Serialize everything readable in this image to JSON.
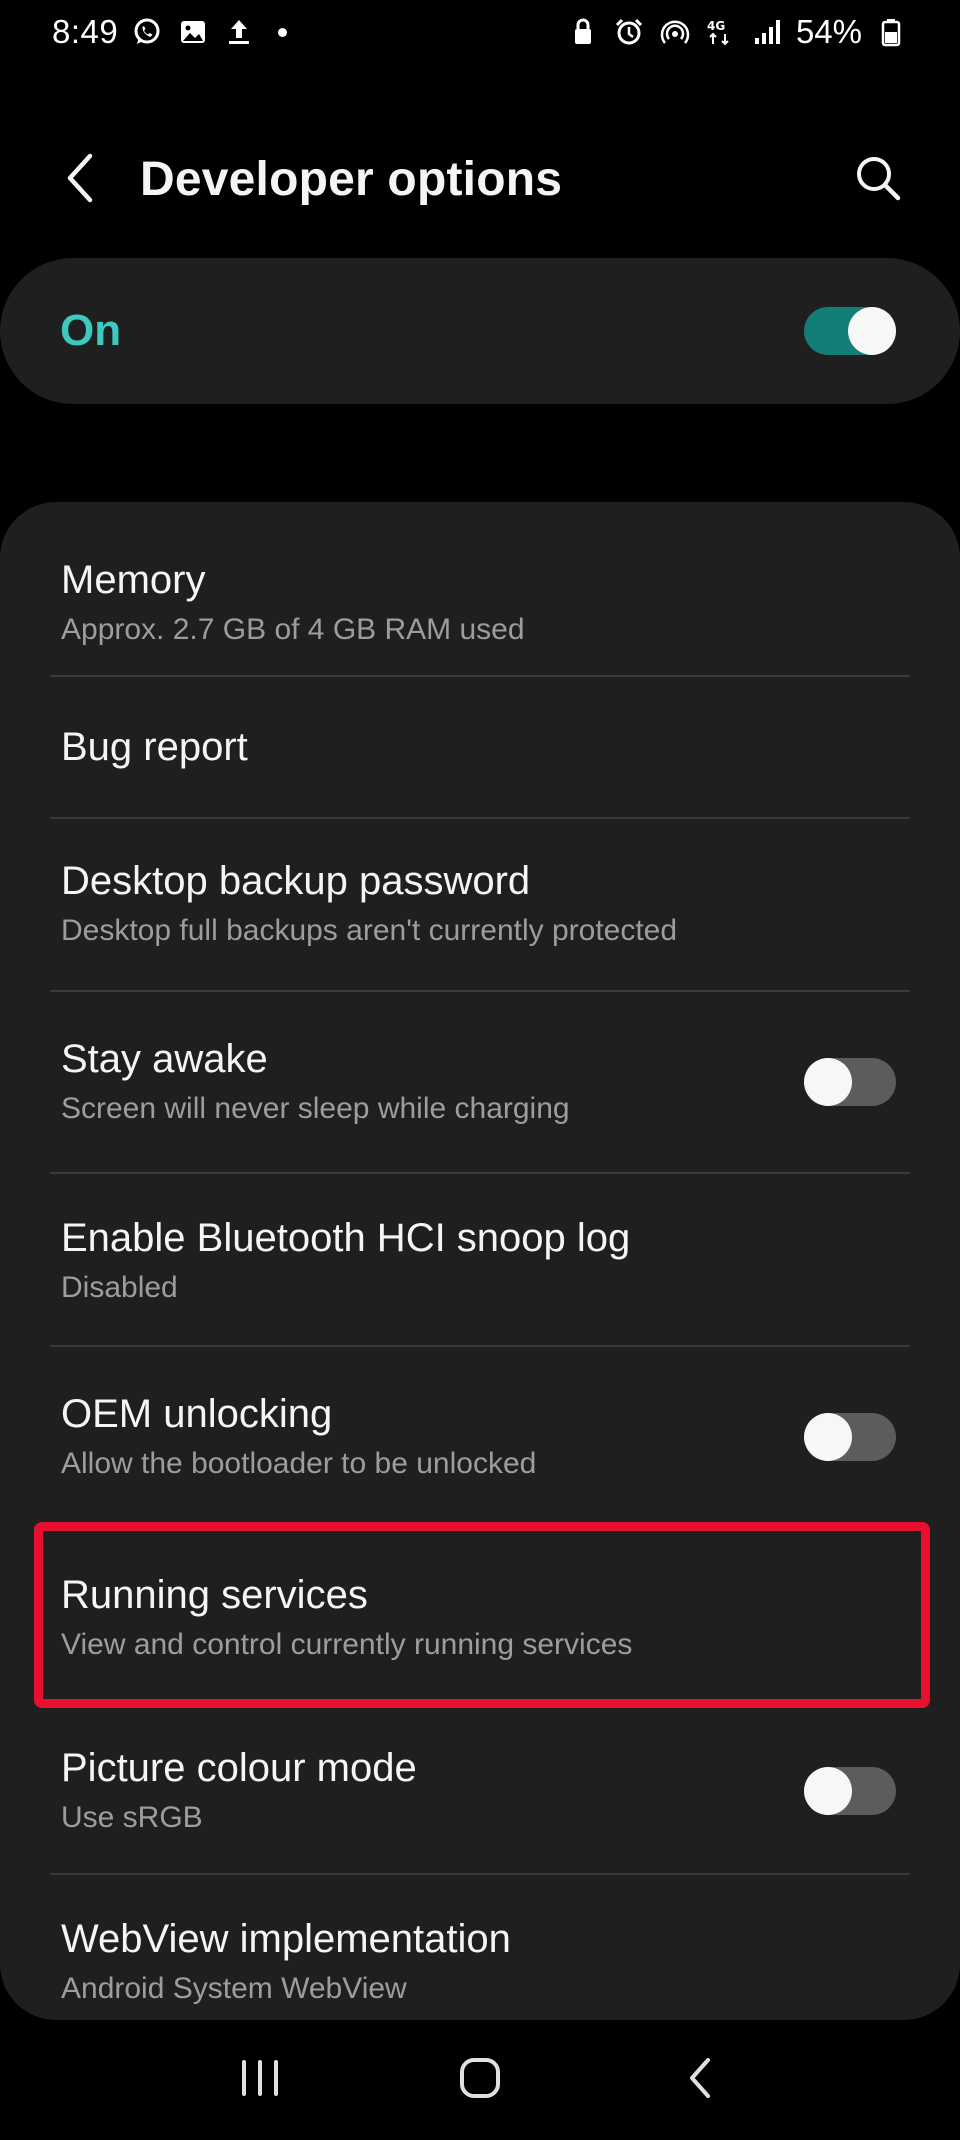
{
  "status_bar": {
    "time": "8:49",
    "battery_percent": "54%",
    "left_icons": [
      "whatsapp-icon",
      "gallery-icon",
      "upload-icon"
    ],
    "right_icons": [
      "lock-icon",
      "alarm-icon",
      "hotspot-icon",
      "4g-lte-icon",
      "signal-icon",
      "battery-icon"
    ]
  },
  "app_bar": {
    "title": "Developer options",
    "back_icon": "chevron-left-icon",
    "search_icon": "search-icon"
  },
  "master_switch": {
    "label": "On",
    "enabled": true,
    "accent_color": "#3fc8c0"
  },
  "settings": [
    {
      "id": "memory",
      "title": "Memory",
      "subtitle": "Approx. 2.7 GB of 4 GB RAM used",
      "toggle": null
    },
    {
      "id": "bug-report",
      "title": "Bug report",
      "subtitle": "",
      "toggle": null
    },
    {
      "id": "desktop-backup-password",
      "title": "Desktop backup password",
      "subtitle": "Desktop full backups aren't currently protected",
      "toggle": null
    },
    {
      "id": "stay-awake",
      "title": "Stay awake",
      "subtitle": "Screen will never sleep while charging",
      "toggle": false
    },
    {
      "id": "bluetooth-hci-snoop-log",
      "title": "Enable Bluetooth HCI snoop log",
      "subtitle": "Disabled",
      "toggle": null
    },
    {
      "id": "oem-unlocking",
      "title": "OEM unlocking",
      "subtitle": "Allow the bootloader to be unlocked",
      "toggle": false
    },
    {
      "id": "running-services",
      "title": "Running services",
      "subtitle": "View and control currently running services",
      "toggle": null,
      "highlighted": true
    },
    {
      "id": "picture-colour-mode",
      "title": "Picture colour mode",
      "subtitle": "Use sRGB",
      "toggle": false
    },
    {
      "id": "webview-implementation",
      "title": "WebView implementation",
      "subtitle": "Android System WebView",
      "toggle": null
    }
  ],
  "highlight_color": "#e8102e",
  "nav_bar": {
    "buttons": [
      "recents-icon",
      "home-icon",
      "back-icon"
    ]
  }
}
